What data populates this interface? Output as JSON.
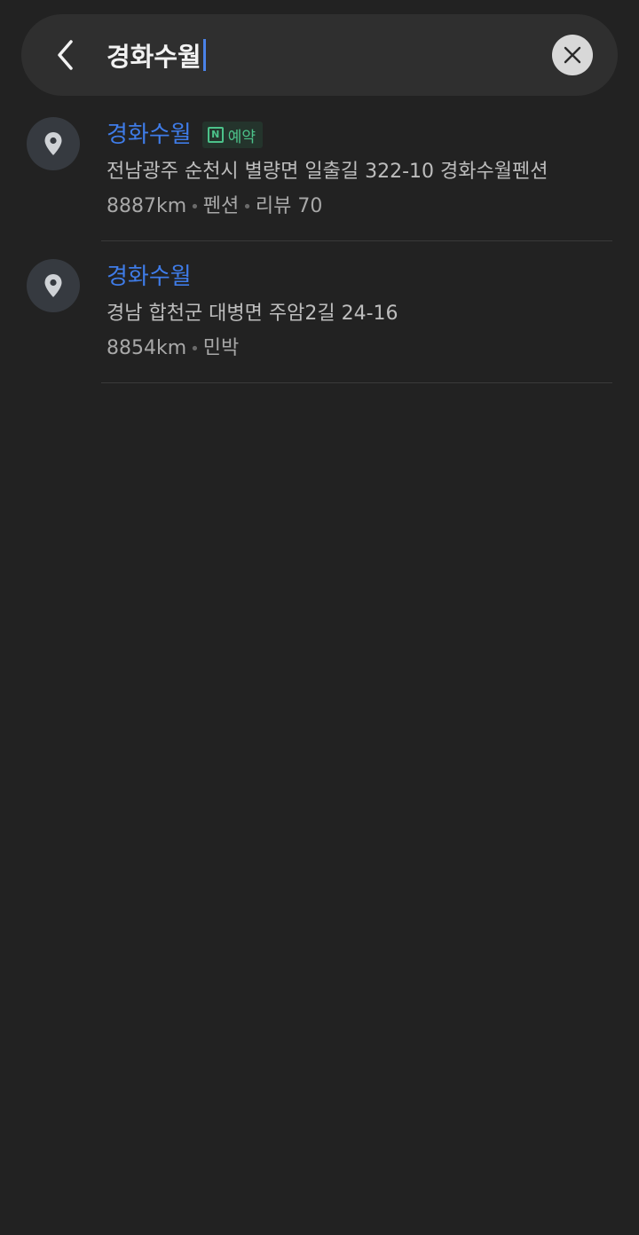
{
  "search": {
    "query": "경화수월"
  },
  "results": [
    {
      "name": "경화수월",
      "badge": "예약",
      "badge_icon": "N",
      "address": "전남광주 순천시 별량면 일출길 322-10 경화수월펜션",
      "distance": "8887km",
      "category": "펜션",
      "reviews": "리뷰 70"
    },
    {
      "name": "경화수월",
      "address": "경남 합천군 대병면 주암2길 24-16",
      "distance": "8854km",
      "category": "민박"
    }
  ],
  "colors": {
    "background": "#222222",
    "name_link": "#3f7ce8",
    "badge_text": "#4cc28a"
  }
}
